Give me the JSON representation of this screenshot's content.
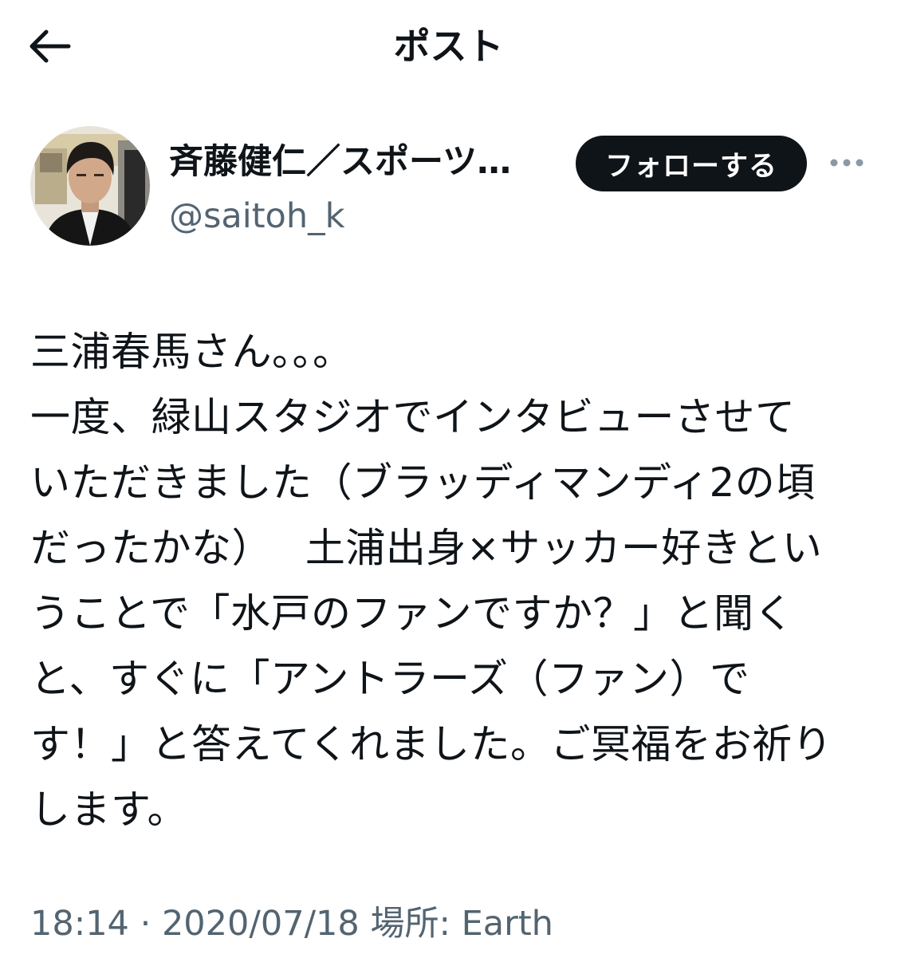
{
  "header": {
    "title": "ポスト"
  },
  "author": {
    "display_name": "斉藤健仁／スポーツ…",
    "handle": "@saitoh_k",
    "follow_label": "フォローする"
  },
  "post": {
    "text": "三浦春馬さん。。。\n一度、緑山スタジオでインタビューさせて\nいただきました（ブラッディマンディ2の頃\nだったかな）　 土浦出身×サッカー好きとい\nうことで「水戸のファンですか？」と聞く\nと、すぐに「アントラーズ（ファン）で\nす！」と答えてくれました。ご冥福をお祈り\nします。"
  },
  "meta": {
    "time": "18:14",
    "separator": "·",
    "date": "2020/07/18",
    "location_label": "場所:",
    "location": "Earth"
  },
  "icons": {
    "back": "arrow-left-icon",
    "more": "more-horizontal-icon"
  },
  "colors": {
    "text": "#0f1419",
    "secondary": "#536471",
    "button_bg": "#0f1419",
    "button_text": "#ffffff"
  }
}
